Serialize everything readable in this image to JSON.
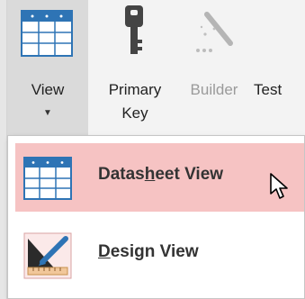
{
  "ribbon": {
    "view": {
      "label": "View",
      "icon": "datasheet-grid-icon"
    },
    "primary_key": {
      "label_line1": "Primary",
      "label_line2": "Key",
      "icon": "key-icon"
    },
    "builder": {
      "label": "Builder",
      "icon": "magic-wand-icon",
      "state": "disabled"
    },
    "test": {
      "label": "Test"
    }
  },
  "view_menu": {
    "items": [
      {
        "label_before": "Datas",
        "label_accel": "h",
        "label_after": "eet View",
        "icon": "datasheet-grid-icon",
        "highlighted": true
      },
      {
        "label_before": "",
        "label_accel": "D",
        "label_after": "esign View",
        "icon": "design-view-icon",
        "highlighted": false
      }
    ]
  },
  "colors": {
    "ribbon_bg": "#f3f3f3",
    "view_button_pressed": "#dadada",
    "menu_highlight": "#f6c3c3",
    "grid_header_blue": "#2e74b5"
  }
}
